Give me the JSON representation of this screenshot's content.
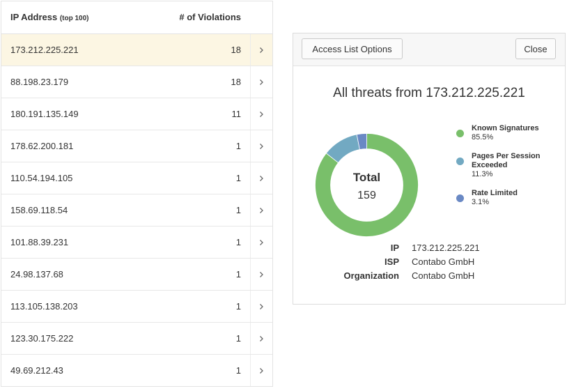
{
  "table": {
    "header_ip": "IP Address",
    "header_ip_note": "(top 100)",
    "header_violations": "# of Violations",
    "rows": [
      {
        "ip": "173.212.225.221",
        "count": "18"
      },
      {
        "ip": "88.198.23.179",
        "count": "18"
      },
      {
        "ip": "180.191.135.149",
        "count": "11"
      },
      {
        "ip": "178.62.200.181",
        "count": "1"
      },
      {
        "ip": "110.54.194.105",
        "count": "1"
      },
      {
        "ip": "158.69.118.54",
        "count": "1"
      },
      {
        "ip": "101.88.39.231",
        "count": "1"
      },
      {
        "ip": "24.98.137.68",
        "count": "1"
      },
      {
        "ip": "113.105.138.203",
        "count": "1"
      },
      {
        "ip": "123.30.175.222",
        "count": "1"
      },
      {
        "ip": "49.69.212.43",
        "count": "1"
      }
    ],
    "selected_row": 0
  },
  "panel": {
    "access_button": "Access List Options",
    "close_button": "Close",
    "title": "All threats from 173.212.225.221",
    "total_label": "Total",
    "total_value": "159",
    "legend": [
      {
        "name": "Known Signatures",
        "pct": "85.5%",
        "value": 85.5,
        "color": "#79bf6a"
      },
      {
        "name": "Pages Per Session Exceeded",
        "pct": "11.3%",
        "value": 11.3,
        "color": "#72a9c2"
      },
      {
        "name": "Rate Limited",
        "pct": "3.1%",
        "value": 3.1,
        "color": "#6a89c4"
      }
    ],
    "details": [
      {
        "key": "IP",
        "value": "173.212.225.221"
      },
      {
        "key": "ISP",
        "value": "Contabo GmbH"
      },
      {
        "key": "Organization",
        "value": "Contabo GmbH"
      }
    ]
  }
}
